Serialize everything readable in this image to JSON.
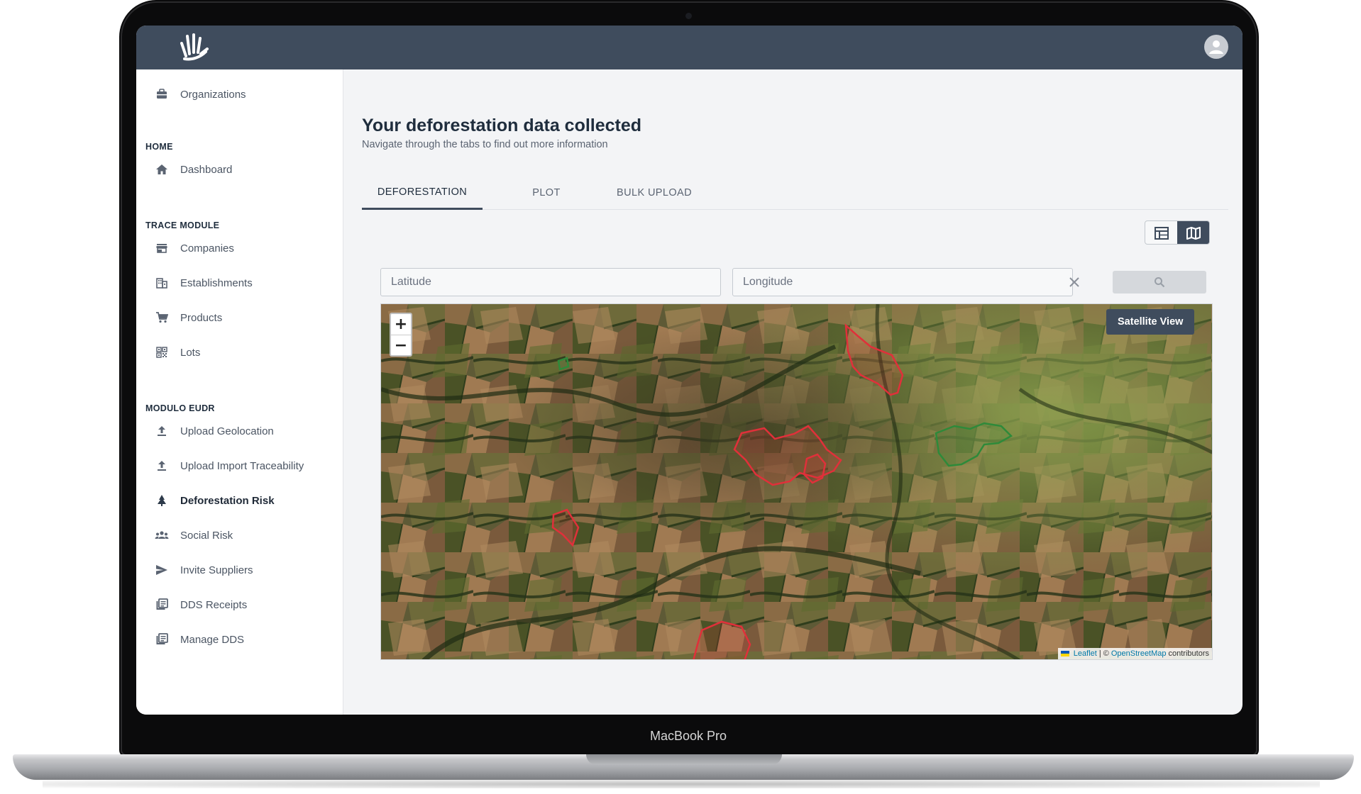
{
  "device": {
    "label": "MacBook Pro"
  },
  "sidebar": {
    "top_item": {
      "label": "Organizations",
      "icon": "briefcase-icon"
    },
    "sections": {
      "home": "HOME",
      "trace": "TRACE MODULE",
      "eudr": "MODULO EUDR"
    },
    "home_items": [
      {
        "label": "Dashboard",
        "icon": "home-icon"
      }
    ],
    "trace_items": [
      {
        "label": "Companies",
        "icon": "store-icon"
      },
      {
        "label": "Establishments",
        "icon": "building-icon"
      },
      {
        "label": "Products",
        "icon": "cart-icon"
      },
      {
        "label": "Lots",
        "icon": "qr-icon"
      }
    ],
    "eudr_items": [
      {
        "label": "Upload Geolocation",
        "icon": "upload-icon"
      },
      {
        "label": "Upload Import Traceability",
        "icon": "upload-icon"
      },
      {
        "label": "Deforestation Risk",
        "icon": "tree-icon",
        "active": true
      },
      {
        "label": "Social Risk",
        "icon": "group-icon"
      },
      {
        "label": "Invite Suppliers",
        "icon": "send-icon"
      },
      {
        "label": "DDS Receipts",
        "icon": "library-icon"
      },
      {
        "label": "Manage DDS",
        "icon": "library-icon"
      }
    ]
  },
  "main": {
    "title": "Your deforestation data collected",
    "subtitle": "Navigate through the tabs to find out more information",
    "tabs": [
      {
        "label": "DEFORESTATION",
        "active": true
      },
      {
        "label": "PLOT"
      },
      {
        "label": "BULK UPLOAD"
      }
    ],
    "view_toggle": {
      "table_icon": "table-icon",
      "map_icon": "map-icon",
      "selected": "map"
    },
    "search": {
      "latitude_placeholder": "Latitude",
      "longitude_placeholder": "Longitude",
      "clear_icon": "close-icon",
      "search_icon": "search-icon"
    },
    "map": {
      "zoom_in": "+",
      "zoom_out": "−",
      "layer_button": "Satellite View",
      "attribution": {
        "leaflet": "Leaflet",
        "separator": "| ©",
        "osm": "OpenStreetMap",
        "suffix": "contributors"
      },
      "colors": {
        "risk": "#e0303a",
        "safe": "#2e8a3a"
      }
    }
  }
}
